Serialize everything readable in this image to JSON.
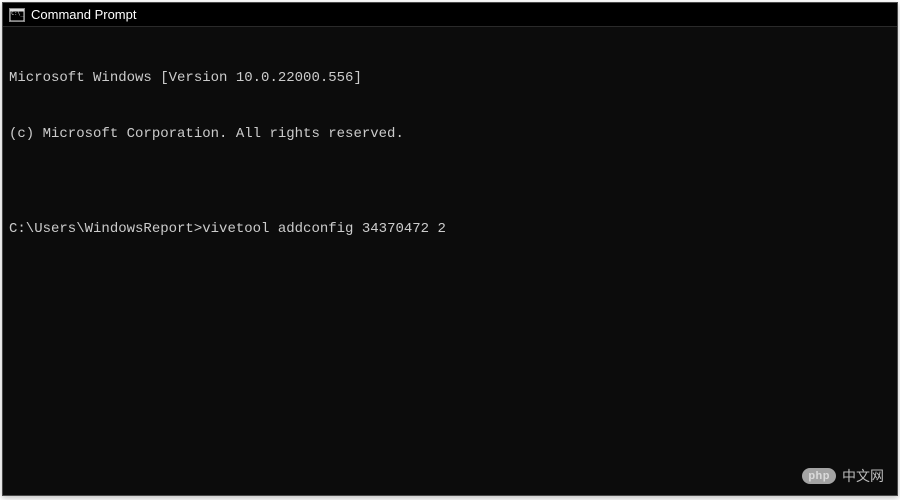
{
  "window": {
    "title": "Command Prompt"
  },
  "terminal": {
    "banner_line1": "Microsoft Windows [Version 10.0.22000.556]",
    "banner_line2": "(c) Microsoft Corporation. All rights reserved.",
    "blank": "",
    "prompt": "C:\\Users\\WindowsReport>",
    "command": "vivetool addconfig 34370472 2"
  },
  "watermark": {
    "badge": "php",
    "text": "中文网"
  }
}
